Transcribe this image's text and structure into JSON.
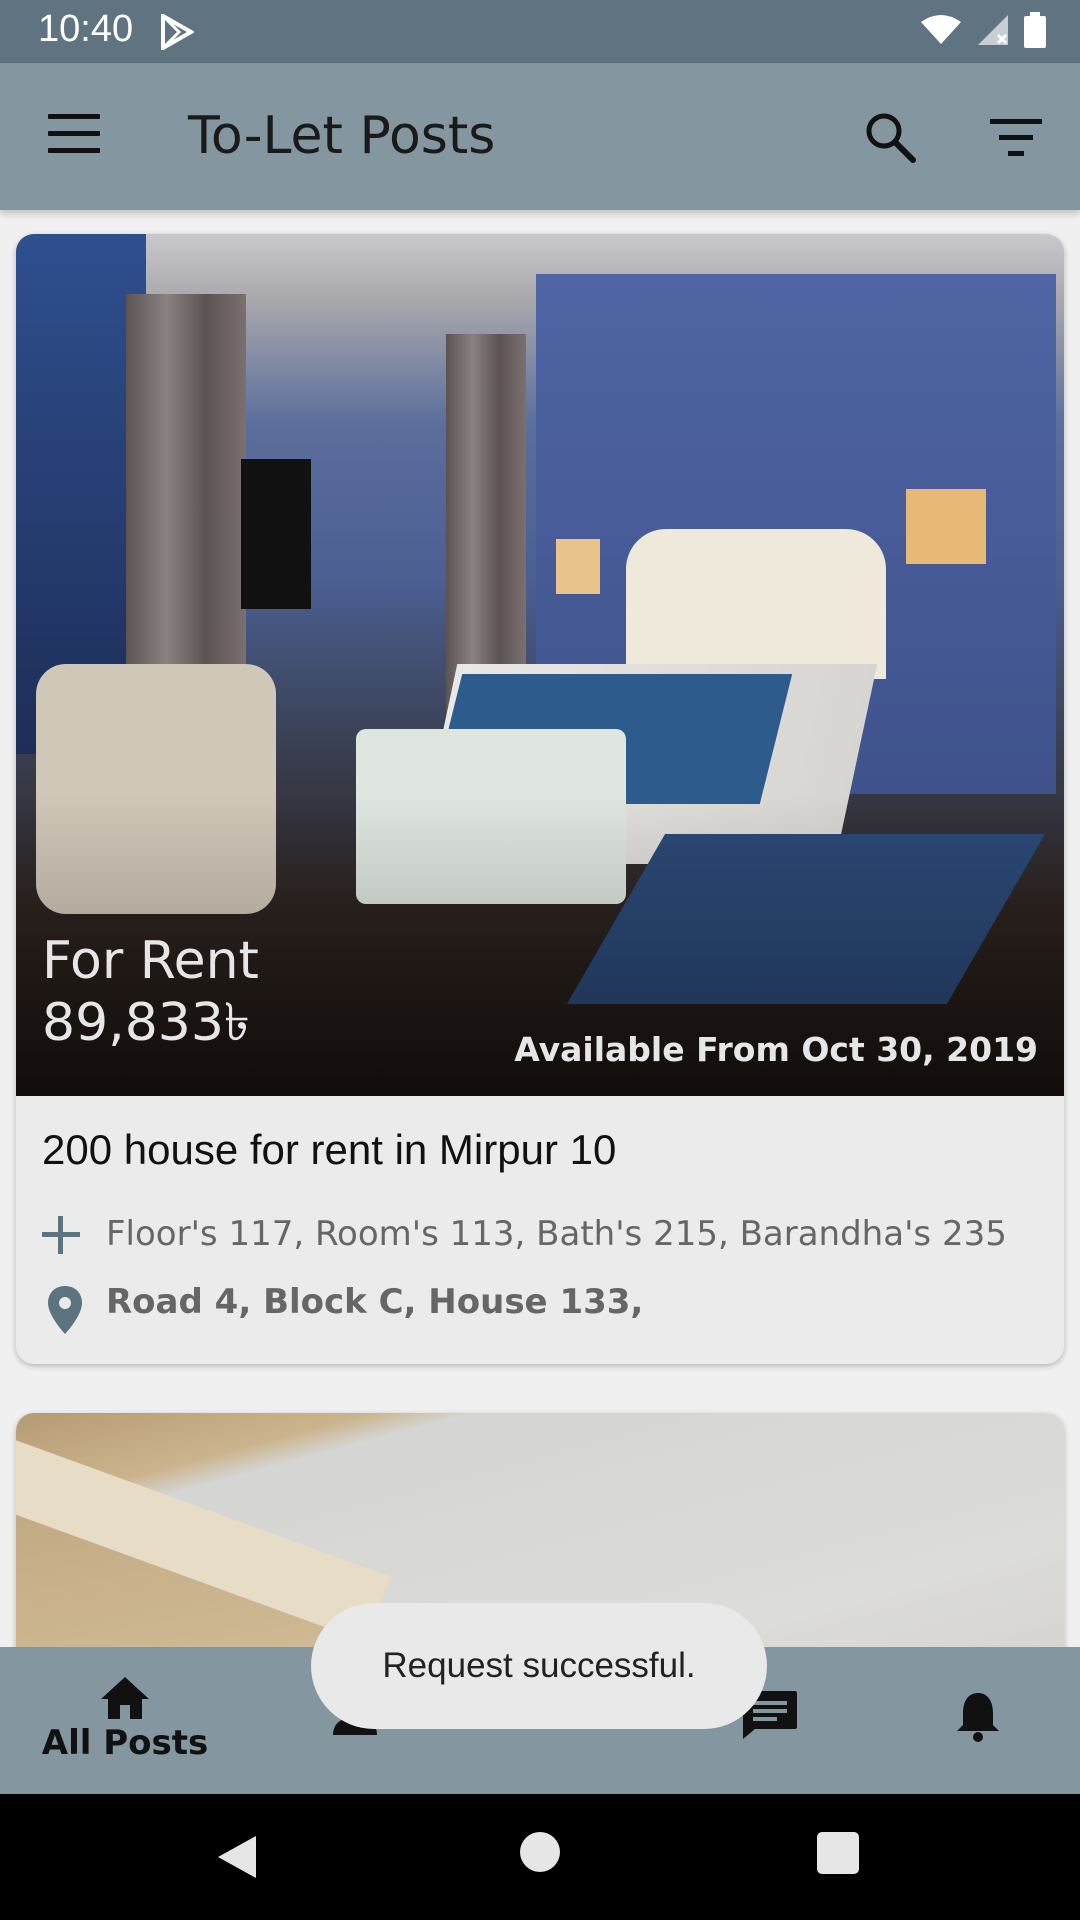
{
  "status_bar": {
    "time": "10:40"
  },
  "app_bar": {
    "title": "To-Let Posts"
  },
  "posts": [
    {
      "type_label": "For Rent",
      "price": "89,833৳",
      "available": "Available From Oct 30, 2019",
      "title": "200 house for rent in Mirpur 10",
      "features": "Floor's 117, Room's 113, Bath's 215, Barandha's 235",
      "address": "Road 4, Block C, House 133,"
    }
  ],
  "bottom_nav": {
    "items": [
      {
        "label": "All Posts",
        "icon": "home-icon",
        "selected": true
      },
      {
        "label": "",
        "icon": "person-icon"
      },
      {
        "label": "",
        "icon": "add-icon"
      },
      {
        "label": "",
        "icon": "chat-icon"
      },
      {
        "label": "",
        "icon": "bell-icon"
      }
    ]
  },
  "toast": {
    "message": "Request successful."
  },
  "colors": {
    "app_bar": "#84969f",
    "status_bar": "#5f7480",
    "accent": "#5c7380"
  }
}
